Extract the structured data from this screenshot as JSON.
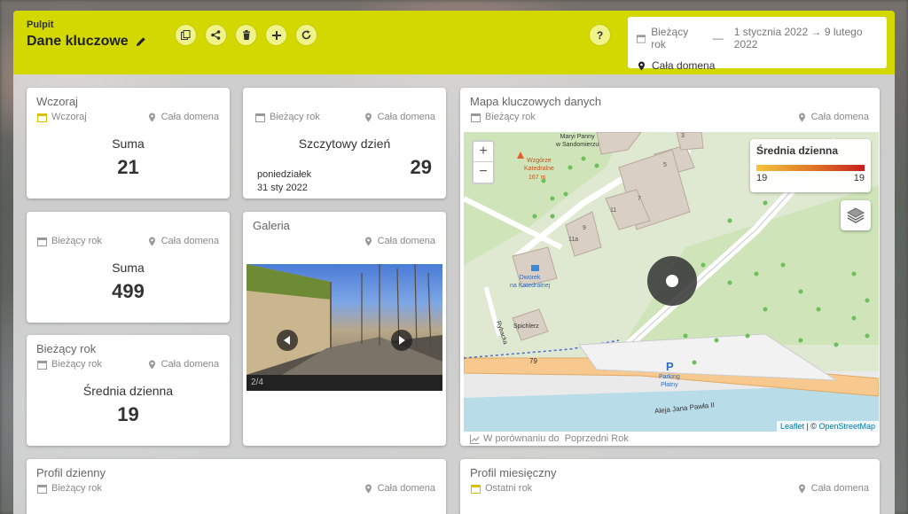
{
  "header": {
    "breadcrumb": "Pulpit",
    "title": "Dane kluczowe",
    "help": "?",
    "range": {
      "period": "Bieżący rok",
      "dash": "—",
      "dates": "1 stycznia 2022 → 9 lutego 2022",
      "scope": "Cała domena"
    }
  },
  "cards": {
    "yesterday": {
      "title": "Wczoraj",
      "period": "Wczoraj",
      "scope": "Cała domena",
      "label": "Suma",
      "value": "21"
    },
    "peak": {
      "period": "Bieżący rok",
      "scope": "Cała domena",
      "label": "Szczytowy dzień",
      "value": "29",
      "day": "poniedziałek",
      "date": "31 sty 2022"
    },
    "year_sum": {
      "period": "Bieżący rok",
      "scope": "Cała domena",
      "label": "Suma",
      "value": "499"
    },
    "gallery": {
      "title": "Galeria",
      "scope": "Cała domena",
      "counter": "2/4"
    },
    "year_avg": {
      "title": "Bieżący rok",
      "period": "Bieżący rok",
      "scope": "Cała domena",
      "label": "Średnia dzienna",
      "value": "19"
    },
    "map": {
      "title": "Mapa kluczowych danych",
      "period": "Bieżący rok",
      "scope": "Cała domena",
      "zoom_in": "+",
      "zoom_out": "−",
      "legend_title": "Średnia dzienna",
      "legend_min": "19",
      "legend_max": "19",
      "labels": {
        "church": "Maryi Panny\nw Sandomierzu",
        "hill": "Wzgórze\nKatedralne",
        "hill_height": "167 m",
        "manor": "Dworek\nna Katedralnej",
        "granary": "Spichlerz",
        "parking": "Parking\nPłatny",
        "road79": "79",
        "street": "Aleja Jana Pawła II",
        "rybacka": "Rybacka",
        "b5": "5",
        "b7": "7",
        "b9": "9",
        "b11": "11",
        "b11a": "11a",
        "b3": "3"
      },
      "attribution_leaflet": "Leaflet",
      "attribution_sep": " | © ",
      "attribution_osm": "OpenStreetMap",
      "compare_text": "W porównaniu do  Poprzedni Rok"
    },
    "daily_profile": {
      "title": "Profil dzienny",
      "period": "Bieżący rok",
      "scope": "Cała domena"
    },
    "monthly_profile": {
      "title": "Profil miesięczny",
      "period": "Ostatni rok",
      "scope": "Cała domena"
    }
  },
  "colors": {
    "header": "#d3d800",
    "accent_icon": "#d8c200"
  }
}
